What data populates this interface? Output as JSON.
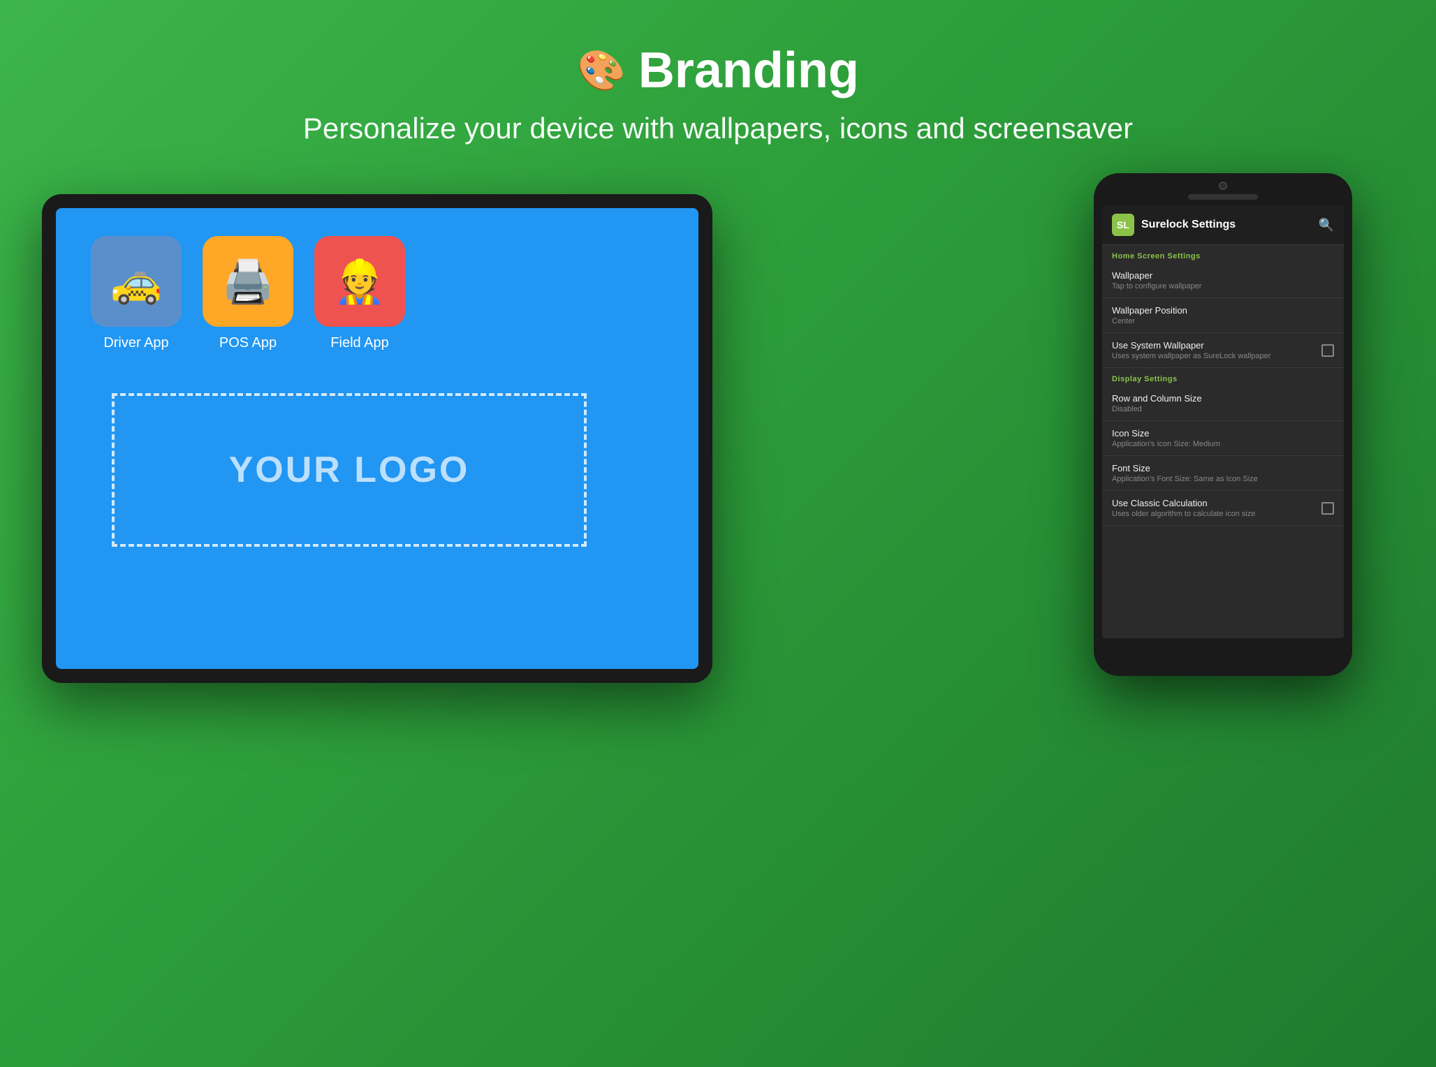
{
  "header": {
    "icon": "🎨",
    "title": "Branding",
    "subtitle": "Personalize your device with wallpapers, icons and screensaver"
  },
  "tablet": {
    "apps": [
      {
        "label": "Driver App",
        "emoji": "🚕",
        "colorClass": "driver-icon"
      },
      {
        "label": "POS App",
        "emoji": "🖨️",
        "colorClass": "pos-icon"
      },
      {
        "label": "Field App",
        "emoji": "👷",
        "colorClass": "field-icon"
      }
    ],
    "logo_placeholder": "YOUR LOGO"
  },
  "phone": {
    "settings_title": "Surelock Settings",
    "logo_text": "SL",
    "sections": [
      {
        "header": "Home Screen Settings",
        "items": [
          {
            "title": "Wallpaper",
            "subtitle": "Tap to configure wallpaper",
            "has_checkbox": false
          },
          {
            "title": "Wallpaper Position",
            "subtitle": "Center",
            "has_checkbox": false
          },
          {
            "title": "Use System Wallpaper",
            "subtitle": "Uses system wallpaper as SureLock wallpaper",
            "has_checkbox": true
          }
        ]
      },
      {
        "header": "Display Settings",
        "items": [
          {
            "title": "Row and Column Size",
            "subtitle": "Disabled",
            "has_checkbox": false
          },
          {
            "title": "Icon Size",
            "subtitle": "Application's Icon Size: Medium",
            "has_checkbox": false
          },
          {
            "title": "Font Size",
            "subtitle": "Application's Font Size: Same as Icon Size",
            "has_checkbox": false
          },
          {
            "title": "Use Classic Calculation",
            "subtitle": "Uses older algorithm to calculate icon size",
            "has_checkbox": true
          }
        ]
      }
    ]
  }
}
